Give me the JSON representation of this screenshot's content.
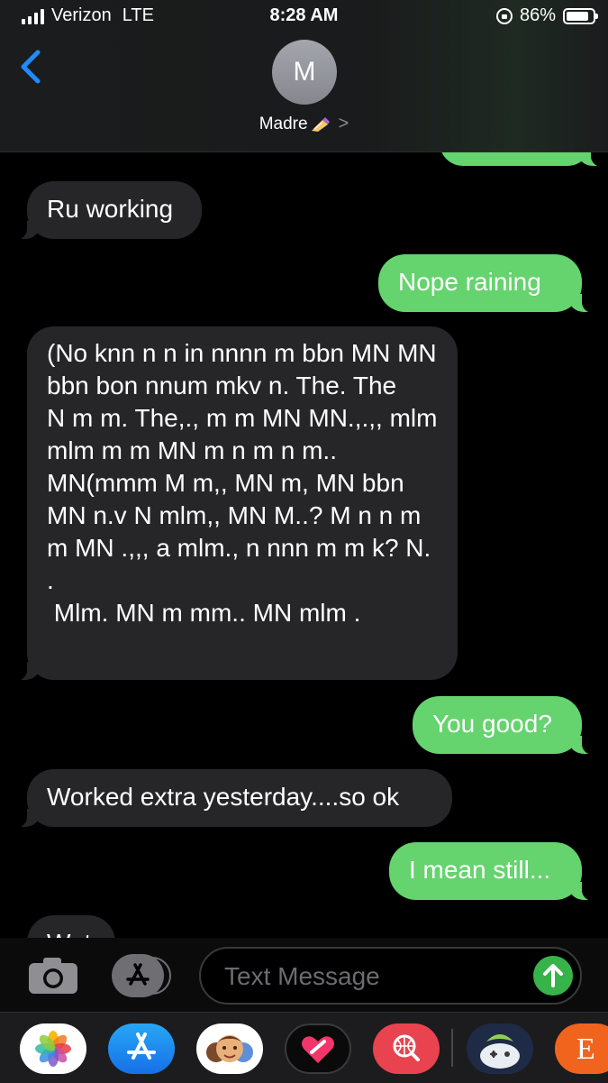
{
  "status_bar": {
    "carrier": "Verizon",
    "network": "LTE",
    "time": "8:28 AM",
    "battery_percent": "86%",
    "battery_level": 0.86,
    "signal_bars": 4
  },
  "header": {
    "avatar_initial": "M",
    "contact_name": "Madre",
    "contact_emoji_icon": "nail-polish-icon",
    "chevron": ">"
  },
  "messages": [
    {
      "sender": "me",
      "text": ""
    },
    {
      "sender": "contact",
      "text": "Ru working"
    },
    {
      "sender": "me",
      "text": "Nope raining"
    },
    {
      "sender": "contact",
      "text": "(No knn n n in nnnn m bbn MN MN bbn bon nnum mkv n. The. The\nN m m. The,., m m MN MN.,.,, mlm mlm m m MN m n m n m.. MN(mmm M m,, MN m, MN bbn MN n.v N mlm,, MN M..? M n n m m MN .,,, a mlm., n nnn m m k? N. .\n Mlm. MN m mm.. MN mlm ."
    },
    {
      "sender": "me",
      "text": "You good?"
    },
    {
      "sender": "contact",
      "text": "Worked extra yesterday....so ok"
    },
    {
      "sender": "me",
      "text": "I mean still..."
    },
    {
      "sender": "contact",
      "text": "Wut"
    }
  ],
  "compose": {
    "placeholder": "Text Message"
  },
  "app_drawer": {
    "apps": [
      "photos-icon",
      "app-store-icon",
      "memoji-icon",
      "digital-touch-icon",
      "images-search-icon",
      "game-pigeon-icon",
      "etsy-icon"
    ],
    "etsy_letter": "E"
  },
  "colors": {
    "outgoing_bubble": "#65d36e",
    "incoming_bubble": "#262629",
    "back_chevron": "#1f8bff",
    "send_button": "#38b34a"
  }
}
